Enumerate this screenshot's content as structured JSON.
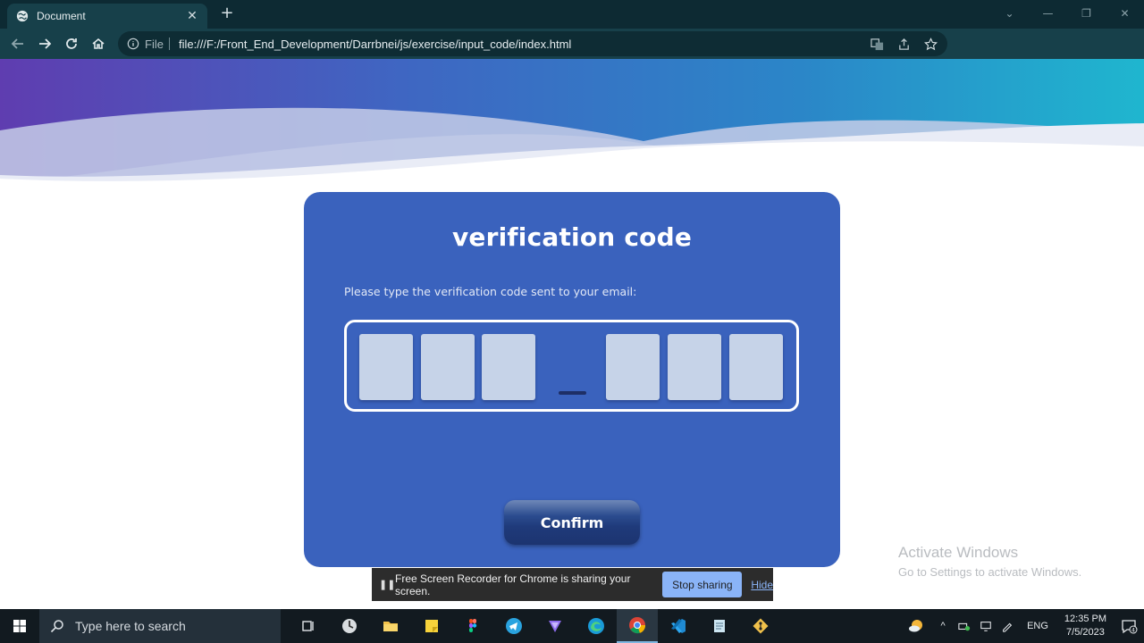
{
  "browser": {
    "tab_title": "Document",
    "url_scheme_label": "File",
    "url": "file:///F:/Front_End_Development/Darrbnei/js/exercise/input_code/index.html"
  },
  "page": {
    "title": "verification code",
    "subtitle": "Please type the verification code sent to your email:",
    "code_digits": [
      "",
      "",
      "",
      "",
      "",
      ""
    ],
    "separator": "–",
    "confirm_label": "Confirm"
  },
  "watermark": {
    "heading": "Activate Windows",
    "subtext": "Go to Settings to activate Windows."
  },
  "share_bar": {
    "message": "Free Screen Recorder for Chrome is sharing your screen.",
    "stop_label": "Stop sharing",
    "hide_label": "Hide"
  },
  "taskbar": {
    "search_placeholder": "Type here to search",
    "language": "ENG",
    "time": "12:35 PM",
    "date": "7/5/2023",
    "notification_count": "4"
  },
  "colors": {
    "card_bg": "#3a62bd",
    "digit_bg": "#c6d3e8",
    "chrome_frame": "#0d2a33",
    "chrome_toolbar": "#17404a",
    "stop_button": "#8ab4f8"
  }
}
